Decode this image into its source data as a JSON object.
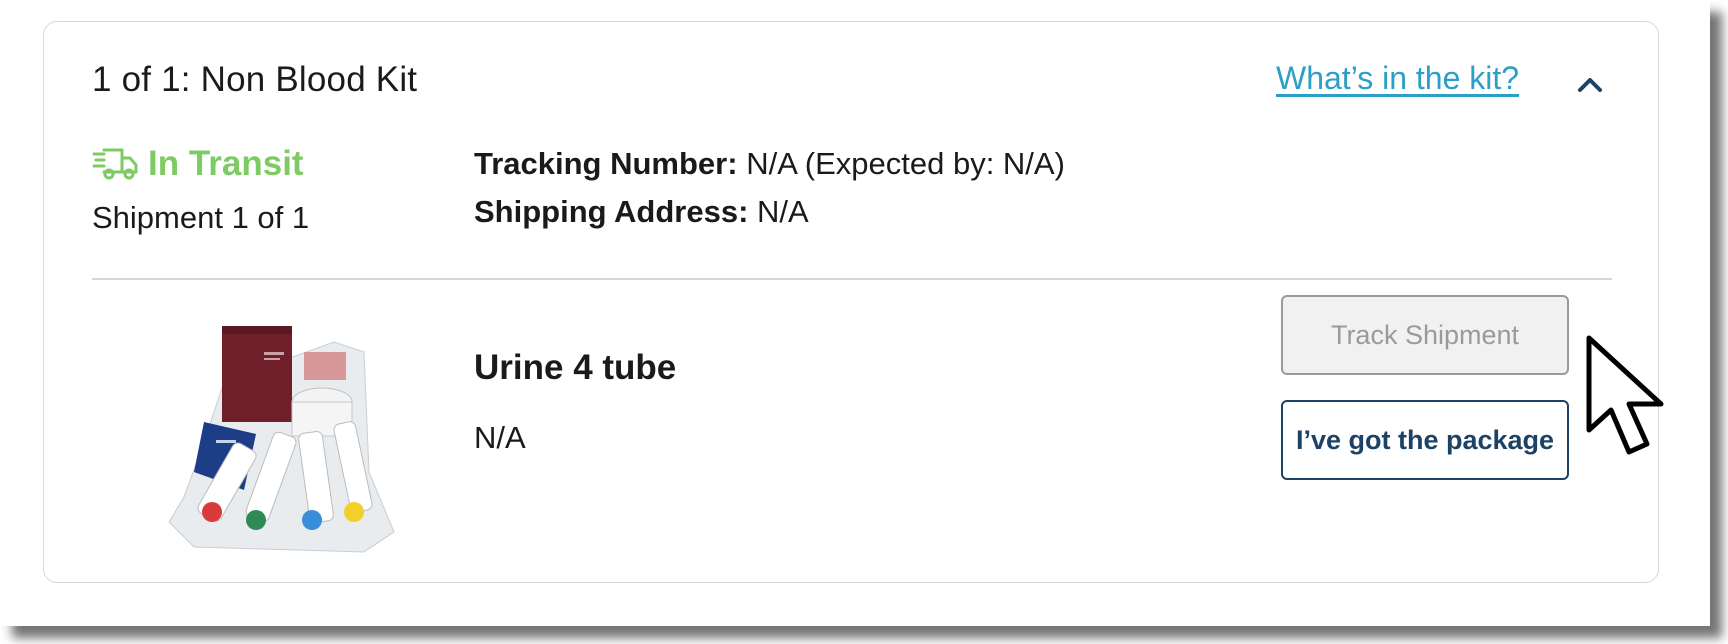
{
  "kit": {
    "title": "1 of 1: Non Blood Kit",
    "link_label": "What’s in the kit?",
    "collapse_icon": "chevron-up-icon"
  },
  "shipment": {
    "status_icon": "truck-icon",
    "status": "In Transit",
    "status_color": "#7ecb63",
    "count": "Shipment 1 of 1",
    "tracking_label": "Tracking Number:",
    "tracking_value": "N/A (Expected by: N/A)",
    "address_label": "Shipping Address:",
    "address_value": "N/A"
  },
  "product": {
    "image_alt": "urine collection kit photo",
    "name": "Urine 4 tube",
    "sub": "N/A"
  },
  "actions": {
    "track_label": "Track Shipment",
    "got_label": "I’ve got the package"
  },
  "colors": {
    "link": "#2a9fc7",
    "primary": "#1c4266",
    "disabled": "#9a9a9a"
  }
}
